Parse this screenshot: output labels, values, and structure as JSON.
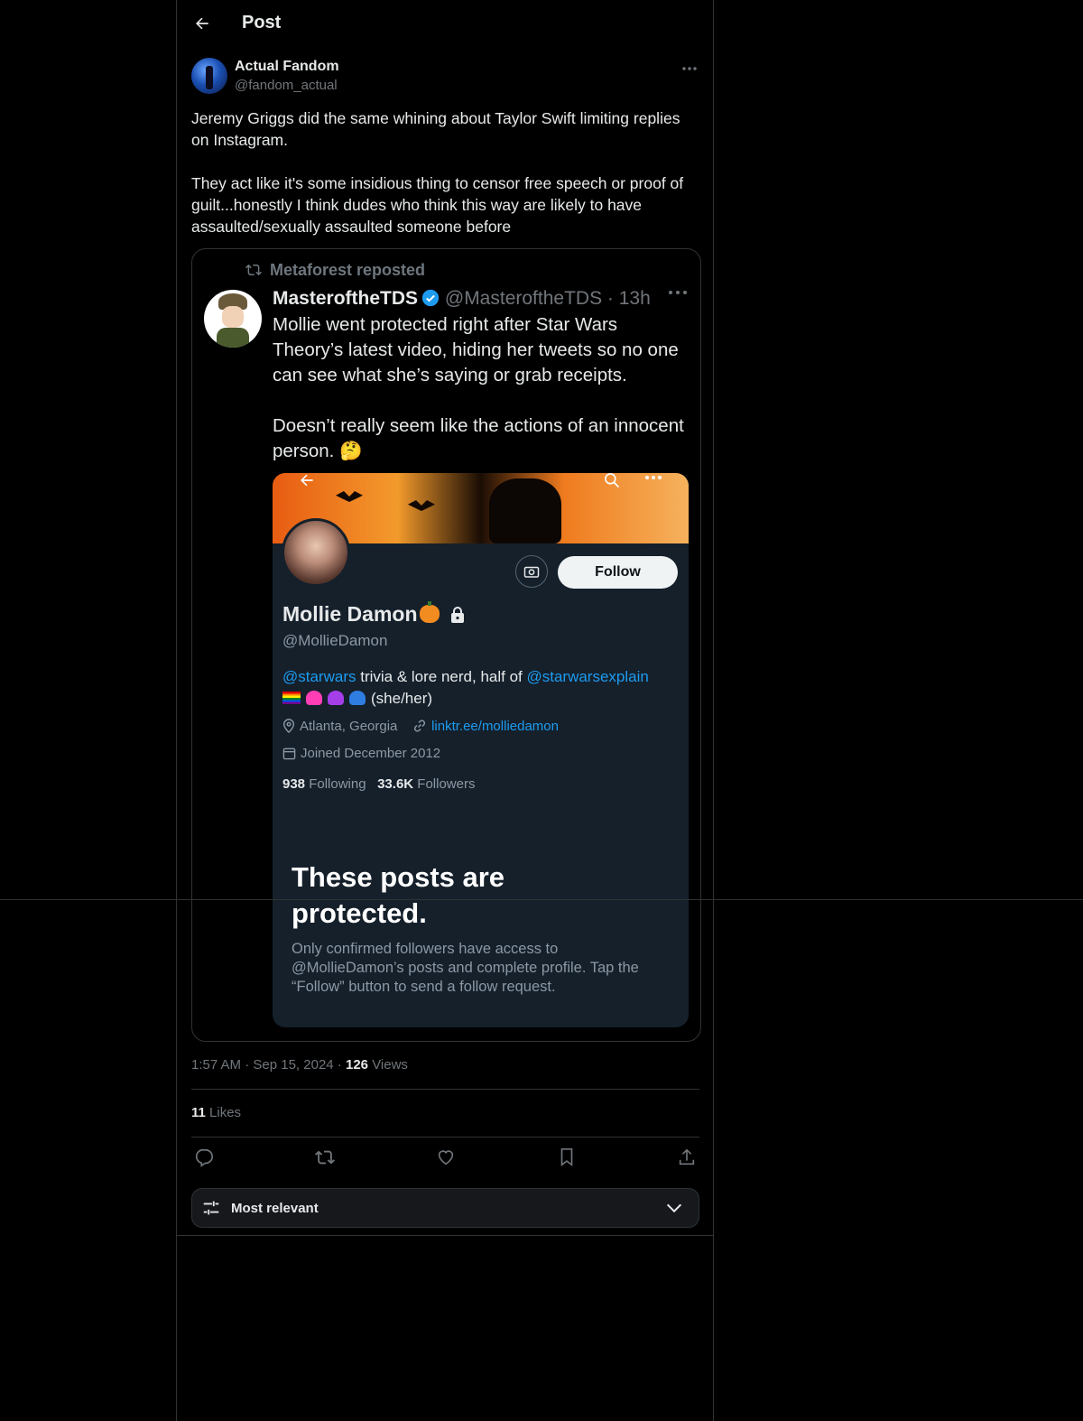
{
  "header": {
    "title": "Post"
  },
  "post": {
    "author_name": "Actual Fandom",
    "author_handle": "@fandom_actual",
    "text": "Jeremy Griggs did the same whining about Taylor Swift limiting replies on Instagram.\n\nThey act like it's some insidious thing to censor free speech or proof of guilt...honestly I think dudes who think this way are likely to have assaulted/sexually assaulted someone before",
    "time": "1:57 AM",
    "date": "Sep 15, 2024",
    "views_count": "126",
    "views_label": "Views",
    "likes_count": "11",
    "likes_label": "Likes"
  },
  "embedded": {
    "reposted_by": "Metaforest reposted",
    "name": "MasteroftheTDS",
    "handle_time": "@MasteroftheTDS · 13h",
    "text": "Mollie went protected right after Star Wars Theory’s latest video, hiding her tweets so no one can see what she’s saying or grab receipts.\n\nDoesn’t really seem like the actions of an innocent person. 🤔",
    "profile": {
      "follow_label": "Follow",
      "name": "Mollie Damon",
      "handle": "@MollieDamon",
      "bio_mention1": "@starwars",
      "bio_mid": " trivia & lore nerd, half of ",
      "bio_mention2": "@starwarsexplain",
      "bio_pronouns": "(she/her)",
      "location": "Atlanta, Georgia",
      "link": "linktr.ee/molliedamon",
      "joined": "Joined December 2012",
      "following_count": "938",
      "following_label": "Following",
      "followers_count": "33.6K",
      "followers_label": "Followers",
      "protected_heading": "These posts are\nprotected.",
      "protected_text": "Only confirmed followers have access to @MollieDamon’s posts and complete profile. Tap the “Follow” button to send a follow request."
    }
  },
  "sort": {
    "label": "Most relevant"
  },
  "icons": {
    "back": "arrow-left-icon",
    "more": "more-icon",
    "reply": "reply-icon",
    "repost": "repost-icon",
    "like": "heart-icon",
    "bookmark": "bookmark-icon",
    "share": "share-icon",
    "sort": "sliders-icon",
    "chevron": "chevron-down-icon"
  },
  "colors": {
    "background": "#000000",
    "text": "#e7e9ea",
    "muted": "#71767b",
    "border": "#2f3336",
    "link": "#1d9bf0"
  }
}
